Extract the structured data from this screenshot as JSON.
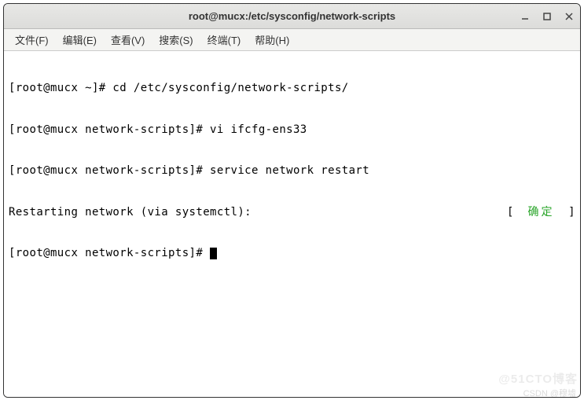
{
  "window": {
    "title": "root@mucx:/etc/sysconfig/network-scripts"
  },
  "menu": {
    "items": [
      {
        "label": "文件(F)"
      },
      {
        "label": "编辑(E)"
      },
      {
        "label": "查看(V)"
      },
      {
        "label": "搜索(S)"
      },
      {
        "label": "终端(T)"
      },
      {
        "label": "帮助(H)"
      }
    ]
  },
  "terminal": {
    "lines": [
      "[root@mucx ~]# cd /etc/sysconfig/network-scripts/",
      "[root@mucx network-scripts]# vi ifcfg-ens33",
      "[root@mucx network-scripts]# service network restart"
    ],
    "status_line": {
      "left": "Restarting network (via systemctl):",
      "right_open": "[  ",
      "right_ok": "确定",
      "right_close": "  ]"
    },
    "prompt_line": "[root@mucx network-scripts]# "
  },
  "watermarks": {
    "w1": "@51CTO博客",
    "w2": "CSDN @穆墟"
  }
}
